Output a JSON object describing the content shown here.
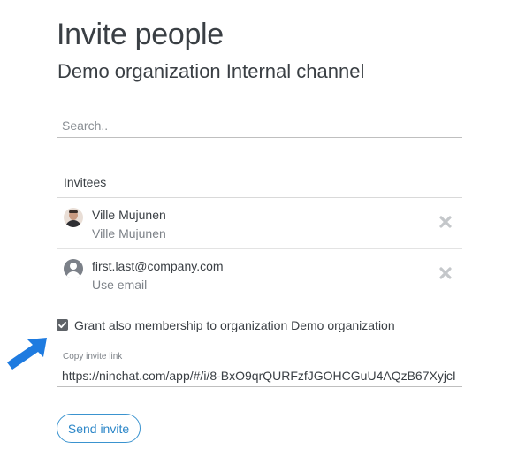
{
  "header": {
    "title": "Invite people",
    "subtitle": "Demo organization Internal channel"
  },
  "search": {
    "placeholder": "Search..",
    "value": ""
  },
  "invitees": {
    "header": "Invitees",
    "items": [
      {
        "name": "Ville Mujunen",
        "detail": "Ville Mujunen",
        "avatar": "user-photo-avatar"
      },
      {
        "name": "first.last@company.com",
        "detail": "Use email",
        "avatar": "generic-user-icon"
      }
    ]
  },
  "grant": {
    "checked": true,
    "label": "Grant also membership to organization Demo organization"
  },
  "invite_link": {
    "label": "Copy invite link",
    "value": "https://ninchat.com/app/#/i/8-BxO9qrQURFzfJGOHCGuU4AQzB67XyjcI"
  },
  "actions": {
    "send_label": "Send invite"
  },
  "colors": {
    "accent": "#2d87c8",
    "arrow": "#1e7be0",
    "text": "#3a3f44"
  }
}
